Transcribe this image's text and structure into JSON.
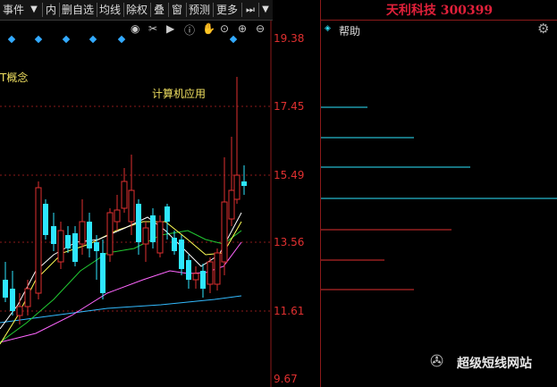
{
  "toolbar": {
    "items": [
      "事件",
      "内",
      "删自选",
      "均线",
      "除权",
      "叠",
      "窗",
      "预测",
      "更多"
    ],
    "icons": [
      "menu-dropdown-icon",
      "play-prev-icon",
      "dropdown-icon"
    ]
  },
  "chart_tools": {
    "icons": [
      "eye-icon",
      "scissors-icon",
      "play-icon",
      "info-icon",
      "hand-icon",
      "target-icon",
      "plus-icon",
      "minus-icon"
    ]
  },
  "chart": {
    "concept_label": "T概念",
    "annotation": "计算机应用",
    "price_axis": [
      "19.38",
      "17.45",
      "15.49",
      "13.56",
      "11.61",
      "9.67"
    ]
  },
  "right_panel": {
    "title": "天利科技 300399",
    "help": "帮助",
    "gear_icon": "gear-icon"
  },
  "watermark": {
    "text": "超级短线网站"
  },
  "colors": {
    "up": "#e03030",
    "down": "#2ee6ff",
    "ma5": "#ffffff",
    "ma10": "#ffff55",
    "ma20": "#22cc33",
    "ma30": "#ff66ff",
    "ma60": "#33bbff",
    "title": "#e0203a"
  }
}
